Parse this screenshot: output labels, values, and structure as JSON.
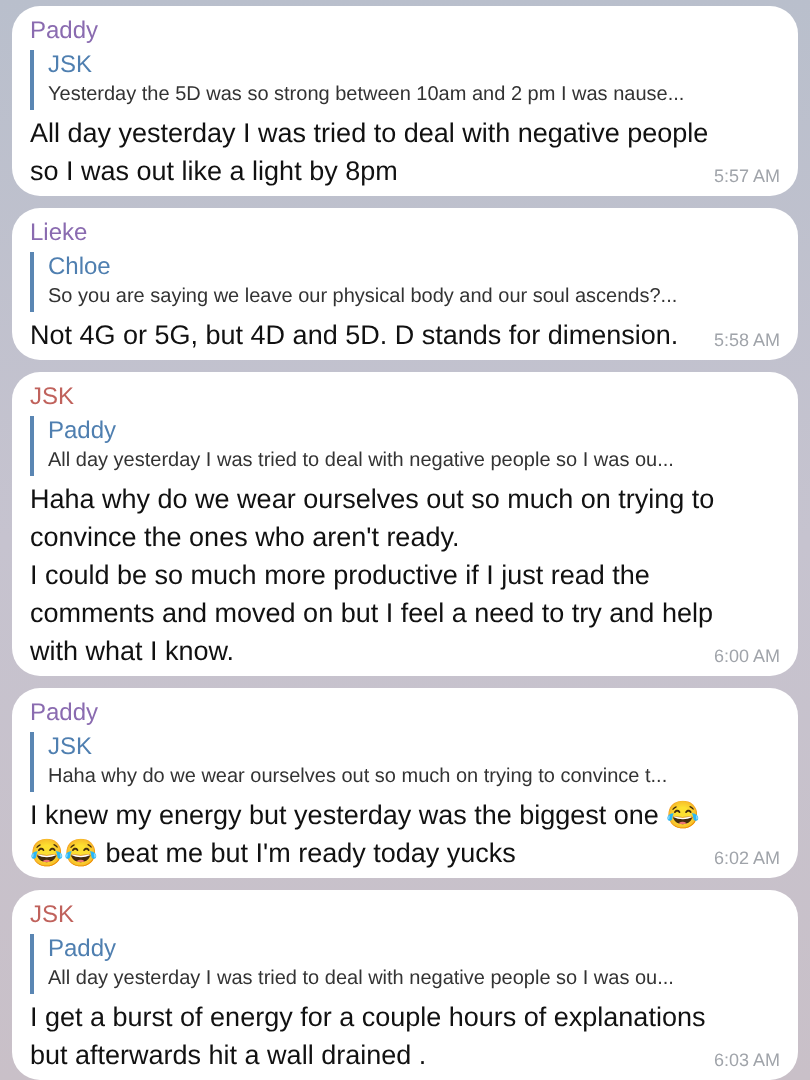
{
  "messages": [
    {
      "sender": "Paddy",
      "color": "#8a6bb0",
      "reply": {
        "name": "JSK",
        "text": "Yesterday the 5D was so strong between 10am and 2 pm I was nause..."
      },
      "lines": [
        "All day yesterday I was tried to deal with negative people",
        "so I was out like a light by 8pm"
      ],
      "time": "5:57 AM"
    },
    {
      "sender": "Lieke",
      "color": "#8a6bb0",
      "reply": {
        "name": "Chloe",
        "text": "So you are saying we leave our physical body and our soul ascends?..."
      },
      "lines": [
        "Not 4G or 5G, but 4D and 5D. D stands for dimension."
      ],
      "time": "5:58 AM"
    },
    {
      "sender": "JSK",
      "color": "#c0625c",
      "reply": {
        "name": "Paddy",
        "text": "All day yesterday I was tried to deal with negative people so I was ou..."
      },
      "lines": [
        "Haha why do we wear ourselves out so much on trying to",
        "convince the ones who aren't ready.",
        "I could be so much more productive if I just read the",
        "comments and moved on but I feel a need to try and help",
        "with what I know."
      ],
      "time": "6:00 AM"
    },
    {
      "sender": "Paddy",
      "color": "#8a6bb0",
      "reply": {
        "name": "JSK",
        "text": "Haha why do we wear ourselves out so much on trying to convince t..."
      },
      "lines": [
        "I knew my energy but yesterday was the biggest one 😂",
        "😂😂 beat me but I'm ready today yucks"
      ],
      "time": "6:02 AM"
    },
    {
      "sender": "JSK",
      "color": "#c0625c",
      "reply": {
        "name": "Paddy",
        "text": "All day yesterday I was tried to deal with negative people so I was ou..."
      },
      "lines": [
        "I get a burst of energy for a couple hours of explanations",
        "but afterwards hit a wall drained ."
      ],
      "time": "6:03 AM"
    }
  ]
}
